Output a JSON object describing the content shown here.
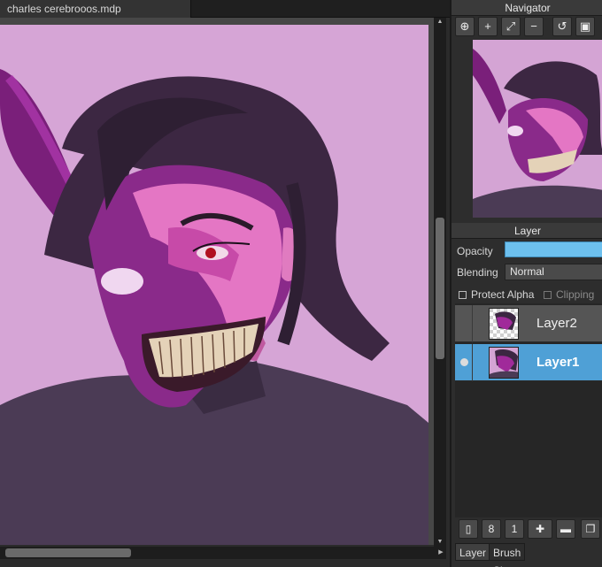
{
  "document_tab": {
    "title": "charles cerebrooos.mdp",
    "close_glyph": "×"
  },
  "navigator": {
    "title": "Navigator",
    "tools": [
      {
        "icon": "zoom-actual-icon",
        "glyph": "⊕"
      },
      {
        "icon": "zoom-in-icon",
        "glyph": "+"
      },
      {
        "icon": "fit-screen-icon",
        "glyph": "⤢"
      },
      {
        "icon": "zoom-out-icon",
        "glyph": "−"
      },
      {
        "icon": "rotate-reset-icon",
        "glyph": "↺"
      },
      {
        "icon": "fullscreen-icon",
        "glyph": "▣"
      }
    ]
  },
  "layer_panel": {
    "title": "Layer",
    "opacity_label": "Opacity",
    "opacity_value": 1.0,
    "blending_label": "Blending",
    "blending_value": "Normal",
    "protect_alpha_label": "Protect Alpha",
    "clipping_label": "Clipping",
    "layers": [
      {
        "name": "Layer2",
        "selected": false,
        "visible": false
      },
      {
        "name": "Layer1",
        "selected": true,
        "visible": true
      }
    ],
    "tools": [
      {
        "icon": "new-layer-icon",
        "glyph": "▯"
      },
      {
        "icon": "new-8bit-layer-icon",
        "glyph": "8"
      },
      {
        "icon": "new-1bit-layer-icon",
        "glyph": "1"
      },
      {
        "icon": "add-layer-menu-icon",
        "glyph": "✚"
      },
      {
        "icon": "new-folder-icon",
        "glyph": "▬"
      },
      {
        "icon": "duplicate-layer-icon",
        "glyph": "❐"
      }
    ]
  },
  "bottom_tabs": [
    {
      "label": "Layer",
      "active": true
    },
    {
      "label": "Brush Size",
      "active": false
    }
  ],
  "colors": {
    "canvas_bg": "#d7a6d7",
    "accent_selected": "#4fa0d6",
    "opacity_fill": "#6dc0ee",
    "panel_bg": "#2d2d2d"
  }
}
